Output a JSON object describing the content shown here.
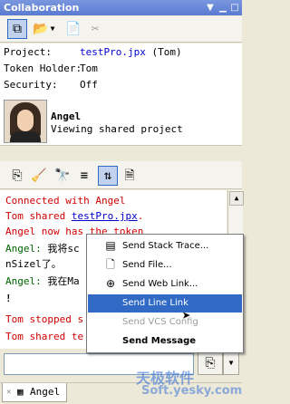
{
  "window": {
    "title": "Collaboration"
  },
  "info": {
    "project_label": "Project:",
    "project_value": "testPro.jpx",
    "project_owner": "(Tom)",
    "token_label": "Token Holder:",
    "token_value": "Tom",
    "security_label": "Security:",
    "security_value": "Off"
  },
  "user": {
    "name": "Angel",
    "status": "Viewing shared project"
  },
  "chat": {
    "line1": "Connected with Angel",
    "line2_prefix": "Tom shared ",
    "line2_link": "testPro.jpx",
    "line2_suffix": ".",
    "line3": "Angel now has the token",
    "line4_name": "Angel:",
    "line4_text": " 我将sc",
    "line5": "nSizel了。",
    "line6_name": "Angel:",
    "line6_text": " 我在Ma",
    "line7": "!",
    "line8": "Tom stopped s",
    "line9": "Tom shared te"
  },
  "menu": {
    "item1": "Send Stack Trace...",
    "item2": "Send File...",
    "item3": "Send Web Link...",
    "item4": "Send Line Link",
    "item5": "Send VCS Config",
    "item6": "Send Message"
  },
  "tabs": {
    "tab1": "Angel"
  },
  "watermark": {
    "line1": "天极软件",
    "line2": "Soft.yesky.com"
  },
  "colors": {
    "highlight": "#316ac5",
    "system_text": "#d00000",
    "user_text": "#006400"
  }
}
